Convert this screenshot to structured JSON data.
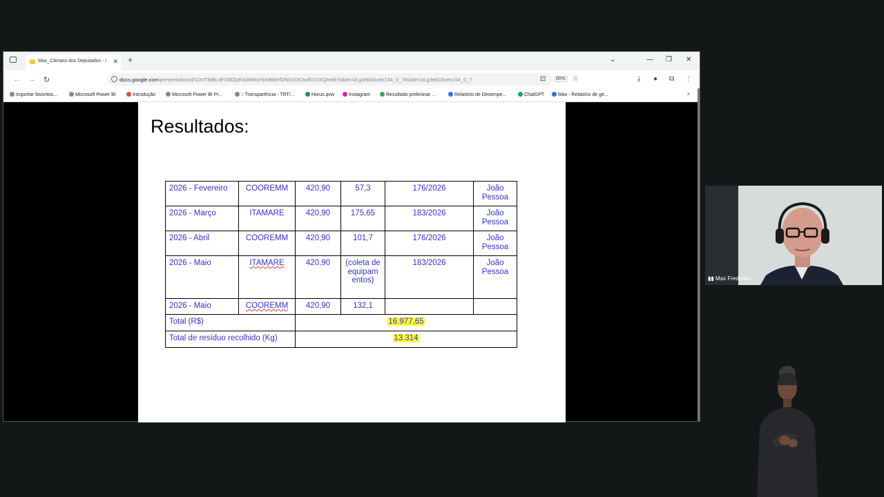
{
  "browser": {
    "tab_title": "Max_Câmara dos Deputados - I",
    "url_domain": "docs.google.com",
    "url_path": "/presentation/d/1DVTMBLdFI36lZpRA8MRd-fnMB8efDNScDK2wllV11KQ/edit?slide=id.g3eb03ceb154_0_7#slide=id.g3eb03ceb154_0_7",
    "zoom": "80%",
    "bookmarks": [
      {
        "label": "Importar favoritos...",
        "color": "#888888"
      },
      {
        "label": "Microsoft Power BI",
        "color": "#888888"
      },
      {
        "label": "Introdução",
        "color": "#e04f3c"
      },
      {
        "label": "Microsoft Power BI Pr...",
        "color": "#888888"
      },
      {
        "label": ":: Transparência - TRT/...",
        "color": "#888888"
      },
      {
        "label": "Horus.qvw",
        "color": "#2e8b57"
      },
      {
        "label": "Instagram",
        "color": "#d6249f"
      },
      {
        "label": "Resultado preliminar ...",
        "color": "#34a853"
      },
      {
        "label": "Relatório de Desempe...",
        "color": "#4169e1"
      },
      {
        "label": "ChatGPT",
        "color": "#10a37f"
      },
      {
        "label": "Max - Relatório de ge...",
        "color": "#3b6fd6"
      }
    ]
  },
  "slide": {
    "title": "Resultados:",
    "rows": [
      {
        "period": "2026 - Fevereiro",
        "company": "COOREMM",
        "value": "420,90",
        "qty": "57,3",
        "doc": "176/2026",
        "city": "João Pessoa"
      },
      {
        "period": "2026 - Março",
        "company": "ITAMARE",
        "value": "420,90",
        "qty": "175,65",
        "doc": "183/2026",
        "city": "João Pessoa"
      },
      {
        "period": "2026 - Abril",
        "company": "COOREMM",
        "value": "420,90",
        "qty": "101,7",
        "doc": "176/2026",
        "city": "João Pessoa"
      },
      {
        "period": "2026 - Maio",
        "company": "ITAMARE",
        "value": "420,90",
        "qty": "(coleta de equipam entos)",
        "doc": "183/2026",
        "city": "João Pessoa"
      },
      {
        "period": "2026 - Maio",
        "company": "COOREMM",
        "value": "420,90",
        "qty": "132,1",
        "doc": "",
        "city": ""
      }
    ],
    "total_label": "Total (R$)",
    "total_value": "16.977,65",
    "waste_label": "Total de resíduo recolhido (Kg)",
    "waste_value": "13.314"
  },
  "participant": {
    "name": "Max Frederico"
  }
}
